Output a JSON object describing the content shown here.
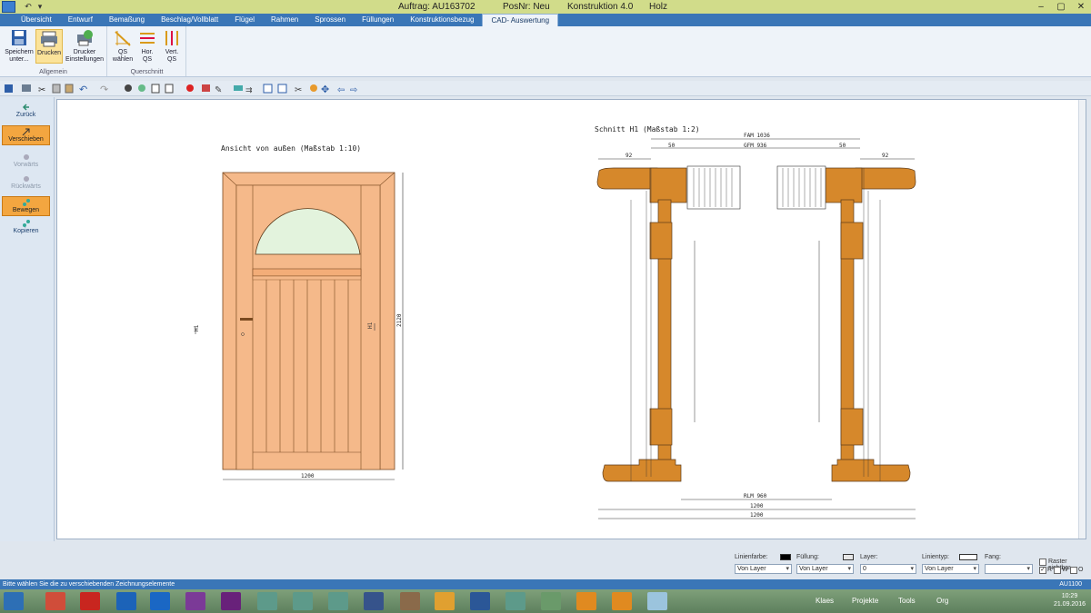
{
  "window": {
    "order": "Auftrag: AU163702",
    "pos": "PosNr: Neu",
    "construction": "Konstruktion 4.0",
    "material": "Holz"
  },
  "tabs": [
    "Übersicht",
    "Entwurf",
    "Bemaßung",
    "Beschlag/Vollblatt",
    "Flügel",
    "Rahmen",
    "Sprossen",
    "Füllungen",
    "Konstruktionsbezug",
    "CAD- Auswertung"
  ],
  "ribbon": {
    "group_allgemein": "Allgemein",
    "group_querschnitt": "Querschnitt",
    "save": "Speichern unter...",
    "print": "Drucken",
    "printer_settings": "Drucker Einstellungen",
    "qs_select": "QS wählen",
    "hor_qs": "Hor. QS",
    "vert_qs": "Vert. QS"
  },
  "left": {
    "back": "Zurück",
    "move_shift": "Verschieben",
    "forward": "Vorwärts",
    "backward": "Rückwärts",
    "move": "Bewegen",
    "copy": "Kopieren"
  },
  "drawing": {
    "view_title": "Ansicht von außen (Maßstab 1:10)",
    "section_title": "Schnitt H1 (Maßstab 1:2)",
    "width_view": "1200",
    "height_view": "2120",
    "fam": "FAM 1036",
    "gfm": "GFM 936",
    "d50a": "50",
    "d50b": "50",
    "d92a": "92",
    "d92b": "92",
    "rlm": "RLM 960",
    "w1200a": "1200",
    "w1200b": "1200",
    "h1": "H1"
  },
  "props": {
    "line_color": "Linienfarbe:",
    "fill": "Füllung:",
    "layer": "Layer:",
    "line_type": "Linientyp:",
    "snap": "Fang:",
    "grid_visible": "Raster sichtbar",
    "from_layer1": "Von Layer",
    "from_layer2": "Von Layer",
    "layer_val": "0",
    "from_layer3": "Von Layer",
    "r": "R",
    "w": "W",
    "o": "O",
    "code": "AU1100"
  },
  "status": "Bitte wählen Sie die zu verschiebenden Zeichnungselemente",
  "taskbar": {
    "klaes": "Klaes",
    "projekte": "Projekte",
    "tools": "Tools",
    "org": "Org",
    "time": "10:29",
    "date": "21.09.2016"
  },
  "colors": {
    "wood_light": "#f5b98a",
    "wood_dark": "#d6882b",
    "ribbon_blue": "#3a76b7",
    "accent_orange": "#f3a640"
  }
}
